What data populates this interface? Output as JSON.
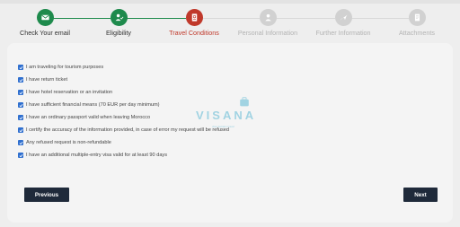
{
  "steps": [
    {
      "label": "Check Your email",
      "icon": "email-icon",
      "status": "done"
    },
    {
      "label": "Eligibility",
      "icon": "person-check-icon",
      "status": "done"
    },
    {
      "label": "Travel Conditions",
      "icon": "passport-icon",
      "status": "active"
    },
    {
      "label": "Personal Information",
      "icon": "user-icon",
      "status": "pending"
    },
    {
      "label": "Further Information",
      "icon": "plane-icon",
      "status": "pending"
    },
    {
      "label": "Attachments",
      "icon": "attachment-icon",
      "status": "pending"
    }
  ],
  "colors": {
    "done": "#1e8a4c",
    "active": "#c0392b",
    "pending": "#d1d1d1",
    "checkbox": "#2f6fcf",
    "button": "#1f2a3a"
  },
  "conditions": [
    {
      "label": "I am traveling for tourism purposes",
      "checked": true
    },
    {
      "label": "I have return ticket",
      "checked": true
    },
    {
      "label": "I have hotel reservation or an invitation",
      "checked": true
    },
    {
      "label": "I have sufficient financial means (70 EUR per day minimum)",
      "checked": true
    },
    {
      "label": "I have an ordinary passport valid when leaving Morocco",
      "checked": true
    },
    {
      "label": "I certify the accuracy of the information provided, in case of error my request will be refused",
      "checked": true
    },
    {
      "label": "Any refused request is non-refundable",
      "checked": true
    },
    {
      "label": "I have an additional multiple-entry visa valid for at least 90 days",
      "checked": true
    }
  ],
  "watermark": {
    "text": "VISANA",
    "sub": "visa vietnam travel"
  },
  "buttons": {
    "previous": "Previous",
    "next": "Next"
  }
}
